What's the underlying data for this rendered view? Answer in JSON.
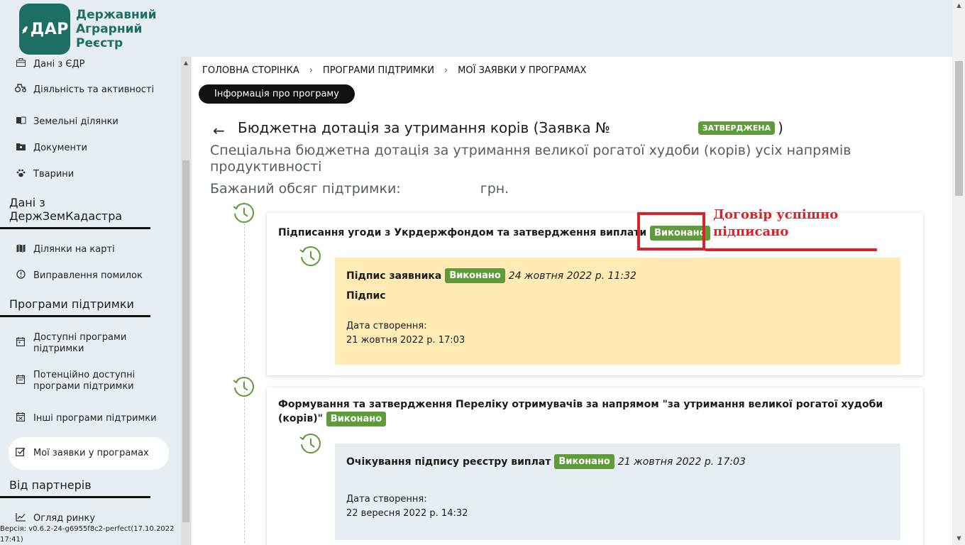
{
  "logo": {
    "mark": "ДАР",
    "lines": [
      "Державний",
      "Аграрний",
      "Реєстр"
    ]
  },
  "sidebar": {
    "top_items": [
      {
        "label": "Дані з ЄДР",
        "icon": "briefcase-icon"
      },
      {
        "label": "Діяльність та активності",
        "icon": "tractor-icon"
      },
      {
        "label": "Земельні ділянки",
        "icon": "book-icon"
      },
      {
        "label": "Документи",
        "icon": "folder-icon"
      },
      {
        "label": "Тварини",
        "icon": "paw-icon"
      }
    ],
    "section_cadastre": "Дані з ДержЗемКадастра",
    "cadastre_items": [
      {
        "label": "Ділянки на карті",
        "icon": "map-icon"
      },
      {
        "label": "Виправлення помилок",
        "icon": "alert-circle-icon"
      }
    ],
    "section_programs": "Програми підтримки",
    "program_items": [
      {
        "label": "Доступні програми підтримки",
        "icon": "calendar-icon"
      },
      {
        "label": "Потенційно доступні програми підтримки",
        "icon": "calendar-icon"
      },
      {
        "label": "Інші програми підтримки",
        "icon": "calendar-icon"
      },
      {
        "label": "Мої заявки у програмах",
        "icon": "checkbox-icon"
      }
    ],
    "section_partners": "Від партнерів",
    "partner_items": [
      {
        "label": "Огляд ринку",
        "icon": "chart-line-icon"
      }
    ],
    "version": "Версія: v0.6.2-24-g6955f8c2-perfect(17.10.2022 17:41)"
  },
  "breadcrumb": [
    "ГОЛОВНА СТОРІНКА",
    "ПРОГРАМИ ПІДТРИМКИ",
    "МОЇ ЗАЯВКИ У ПРОГРАМАХ"
  ],
  "breadcrumb_sep": "›",
  "info_button": "Інформація про програму",
  "page": {
    "back": "←",
    "title_prefix": "Бюджетна дотація за утримання корів (Заявка №",
    "status": "ЗАТВЕРДЖЕНА",
    "title_suffix": ")",
    "subtitle": "Спеціальна бюджетна дотація за утримання великої рогатої худоби (корів) усіх напрямів продуктивності",
    "volume_label": "Бажаний обсяг підтримки:",
    "volume_unit": "грн."
  },
  "steps": [
    {
      "title": "Підписання угоди з Укрдержфондом та затвердження виплати",
      "status": "Виконано",
      "sub": {
        "title": "Підпис заявника",
        "status": "Виконано",
        "date": "24 жовтня 2022 р. 11:32",
        "label": "Підпис",
        "created_label": "Дата створення:",
        "created_value": "21 жовтня 2022 р. 17:03"
      }
    },
    {
      "title": "Формування та затвердження Переліку отримувачів за напрямом \"за утримання великої рогатої худоби (корів)\"",
      "status": "Виконано",
      "sub": {
        "title": "Очікування підпису реєстру виплат",
        "status": "Виконано",
        "date": "21 жовтня 2022 р. 17:03",
        "created_label": "Дата створення:",
        "created_value": "22 вересня 2022 р. 14:32"
      }
    }
  ],
  "annotation": {
    "line1": "Договір успішно",
    "line2": "підписано"
  },
  "colors": {
    "brand": "#1e6f63",
    "done": "#5f9b3a",
    "highlight": "#ffebb3",
    "pending": "#e6edf3",
    "annotation": "#d8232a"
  }
}
